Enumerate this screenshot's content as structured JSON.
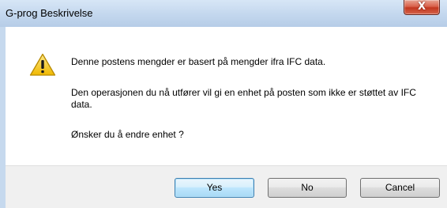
{
  "window": {
    "title": "G-prog Beskrivelse",
    "close_glyph": "X"
  },
  "dialog": {
    "icon": "warning-icon",
    "message_lines": [
      "Denne postens mengder er basert på mengder ifra IFC data.",
      "Den operasjonen du nå utfører vil gi en enhet på posten som ikke er støttet av IFC data.",
      "Ønsker du å endre enhet ?"
    ]
  },
  "buttons": {
    "yes_label": "Yes",
    "no_label": "No",
    "cancel_label": "Cancel"
  },
  "colors": {
    "titlebar": "#c3d7ee",
    "close_button": "#c2371f",
    "default_button_border": "#3c7fb1",
    "warning_fill": "#f5c518"
  }
}
